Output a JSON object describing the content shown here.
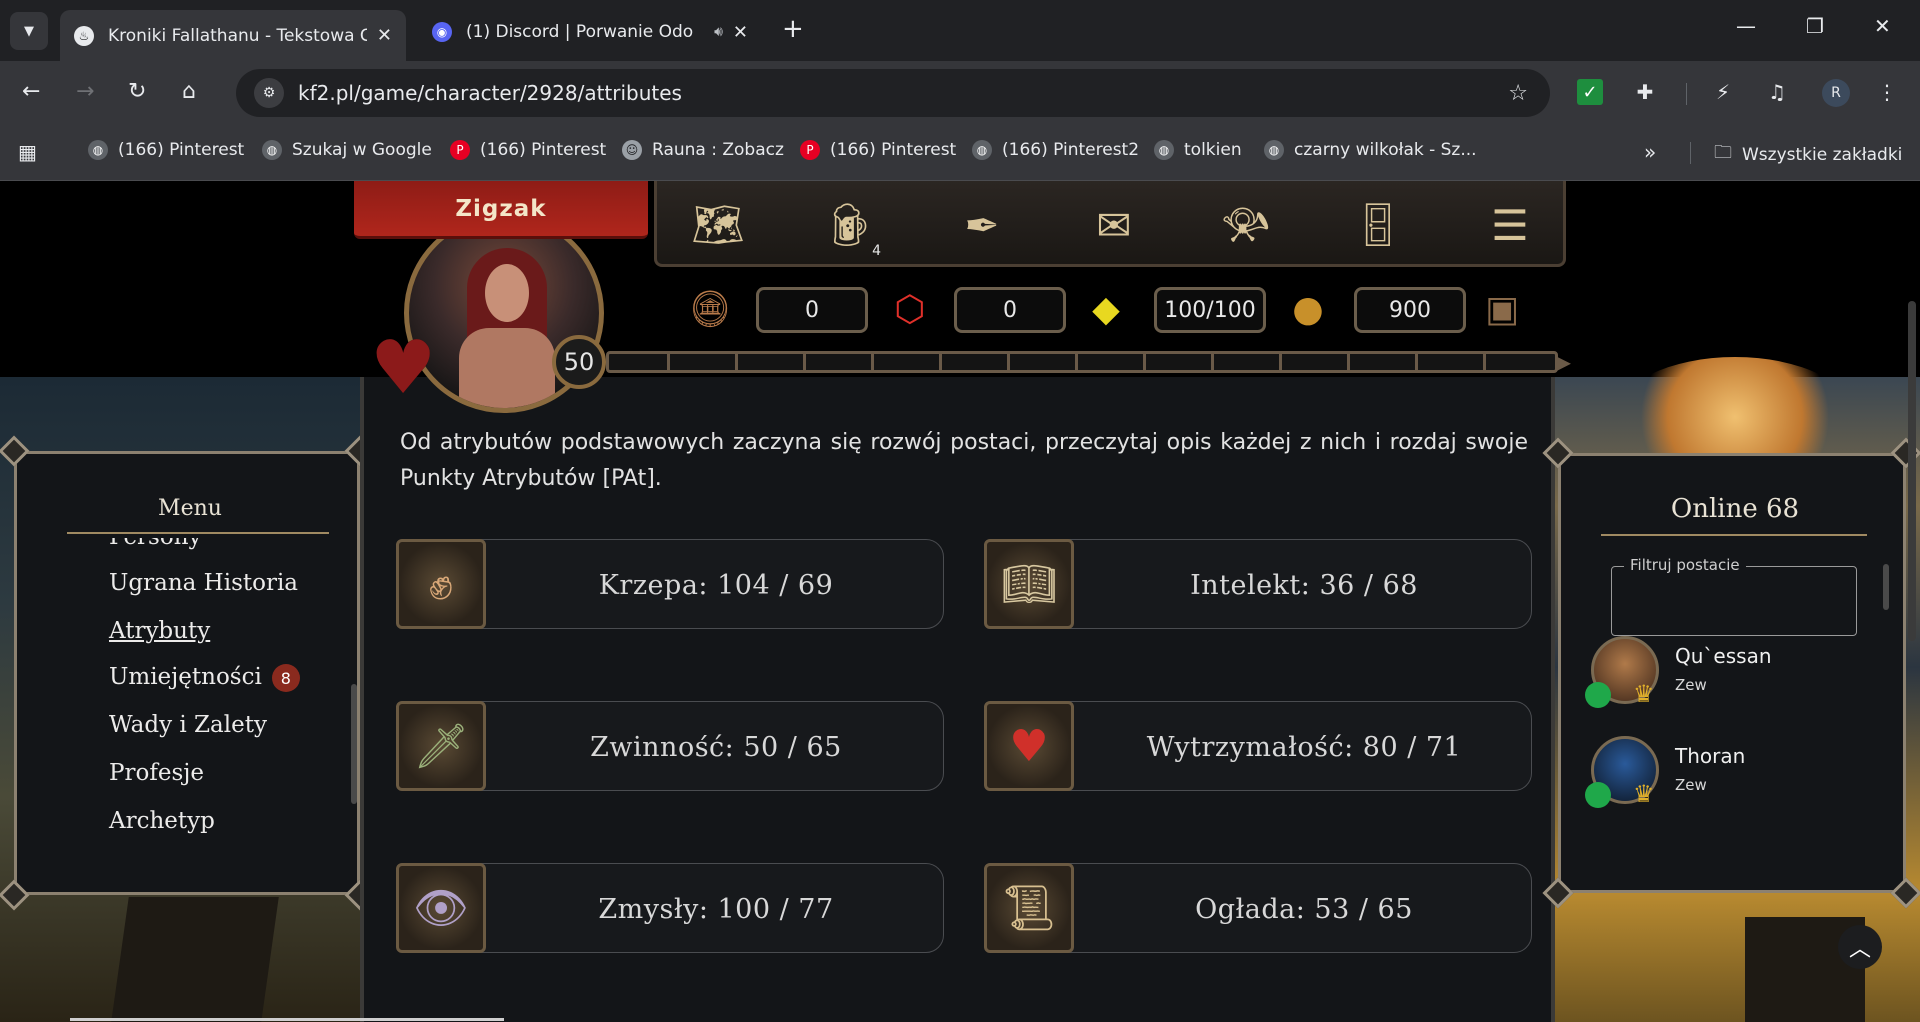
{
  "browser": {
    "tabs": [
      {
        "title": "Kroniki Fallathanu - Tekstowa G",
        "active": true
      },
      {
        "title": "(1) Discord | Porwanie Odo",
        "active": false
      }
    ],
    "url": "kf2.pl/game/character/2928/attributes",
    "profile_initial": "R",
    "bookmarks": [
      {
        "label": "(166) Pinterest",
        "icon": "globe"
      },
      {
        "label": "Szukaj w Google",
        "icon": "globe"
      },
      {
        "label": "(166) Pinterest",
        "icon": "pinterest"
      },
      {
        "label": "Rauna : Zobacz",
        "icon": "avatar"
      },
      {
        "label": "(166) Pinterest",
        "icon": "pinterest"
      },
      {
        "label": "(166) Pinterest2",
        "icon": "globe"
      },
      {
        "label": "tolkien",
        "icon": "globe"
      },
      {
        "label": "czarny wilkołak - Sz...",
        "icon": "globe"
      }
    ],
    "all_bookmarks": "Wszystkie zakładki"
  },
  "character": {
    "name": "Zigzak",
    "level": "50"
  },
  "top_icons": {
    "tavern_badge": "4"
  },
  "resources": {
    "coins": "0",
    "crystals": "0",
    "energy": "100/100",
    "gold": "900"
  },
  "menu": {
    "title": "Menu",
    "items": [
      {
        "label": "Persony"
      },
      {
        "label": "Ugrana Historia"
      },
      {
        "label": "Atrybuty"
      },
      {
        "label": "Umiejętności",
        "badge": "8"
      },
      {
        "label": "Wady i Zalety"
      },
      {
        "label": "Profesje"
      },
      {
        "label": "Archetyp"
      }
    ]
  },
  "content": {
    "intro": "Od atrybutów podstawowych zaczyna się rozwój postaci, przeczytaj opis każdej z nich i rozdaj swoje Punkty Atrybutów [PAt].",
    "attributes": [
      {
        "label": "Krzepa: 104 / 69",
        "icon": "fist-icon"
      },
      {
        "label": "Intelekt: 36 / 68",
        "icon": "book-icon"
      },
      {
        "label": "Zwinność: 50 / 65",
        "icon": "dagger-icon"
      },
      {
        "label": "Wytrzymałość: 80 / 71",
        "icon": "heart-shield-icon"
      },
      {
        "label": "Zmysły: 100 / 77",
        "icon": "eye-shield-icon"
      },
      {
        "label": "Ogłada: 53 / 65",
        "icon": "scrolls-icon"
      }
    ]
  },
  "online": {
    "title": "Online 68",
    "filter_label": "Filtruj postacie",
    "filter_value": "",
    "players": [
      {
        "name": "Qu`essan",
        "tag": "Zew"
      },
      {
        "name": "Thoran",
        "tag": "Zew"
      }
    ]
  }
}
